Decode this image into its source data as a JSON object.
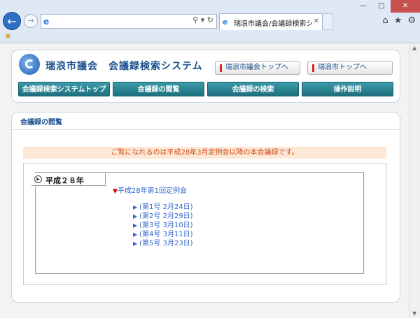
{
  "browser": {
    "tab_title": "瑞浪市議会/会議録検索シ...",
    "window_controls": [
      "minimize-icon",
      "maximize-icon",
      "close-icon"
    ]
  },
  "header": {
    "site_title": "瑞浪市議会　会議録検索システム",
    "link_gikai_top": "瑞浪市議会トップへ",
    "link_shi_top": "瑞浪市トップへ"
  },
  "nav": {
    "items": [
      {
        "label": "会議録検索システムトップ"
      },
      {
        "label": "会議録の閲覧"
      },
      {
        "label": "会議録の検索"
      },
      {
        "label": "操作説明"
      }
    ]
  },
  "content": {
    "section_title": "会議録の閲覧",
    "notice": "ご覧になれるのは平成28年3月定例会以降の本会議録です。",
    "year_label": "平成２８年",
    "session_label": "平成28年第1回定例会",
    "issues": [
      {
        "label": "(第1号 2月24日)"
      },
      {
        "label": "(第2号 2月29日)"
      },
      {
        "label": "(第3号 3月10日)"
      },
      {
        "label": "(第4号 3月11日)"
      },
      {
        "label": "(第5号 3月23日)"
      }
    ]
  },
  "colors": {
    "brand": "#1a4f8e",
    "nav_tab": "#2a8596",
    "notice_bg": "#fde8d6",
    "notice_text": "#d14a17",
    "link": "#3366cc"
  }
}
